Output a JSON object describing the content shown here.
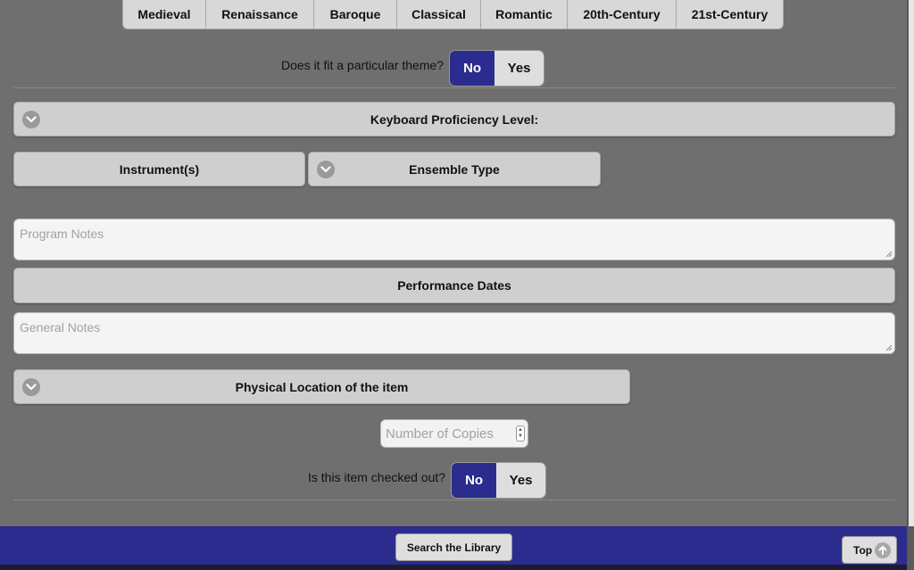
{
  "eras": [
    "Medieval",
    "Renaissance",
    "Baroque",
    "Classical",
    "Romantic",
    "20th-Century",
    "21st-Century"
  ],
  "theme_question": {
    "label": "Does it fit a particular theme?",
    "no": "No",
    "yes": "Yes",
    "selected": "No"
  },
  "keyboard_level": {
    "label": "Keyboard Proficiency Level:",
    "icon": "chevron-down-icon"
  },
  "instruments": {
    "label": "Instrument(s)"
  },
  "ensemble_type": {
    "label": "Ensemble Type",
    "icon": "chevron-down-icon"
  },
  "program_notes": {
    "placeholder": "Program  Notes"
  },
  "performance_dates": {
    "label": "Performance Dates"
  },
  "general_notes": {
    "placeholder": "General Notes"
  },
  "physical_location": {
    "label": "Physical Location of the item",
    "icon": "chevron-down-icon"
  },
  "copies": {
    "placeholder": "Number of Copies"
  },
  "checked_out_question": {
    "label": "Is this item checked out?",
    "no": "No",
    "yes": "Yes",
    "selected": "No"
  },
  "footer": {
    "search_label": "Search the Library",
    "top_label": "Top",
    "top_icon": "arrow-up-icon",
    "background": "#2b2c8e"
  },
  "colors": {
    "accent": "#2b2c8e",
    "page_background": "#6f6f6f",
    "bar_background": "#cfcfcf"
  }
}
